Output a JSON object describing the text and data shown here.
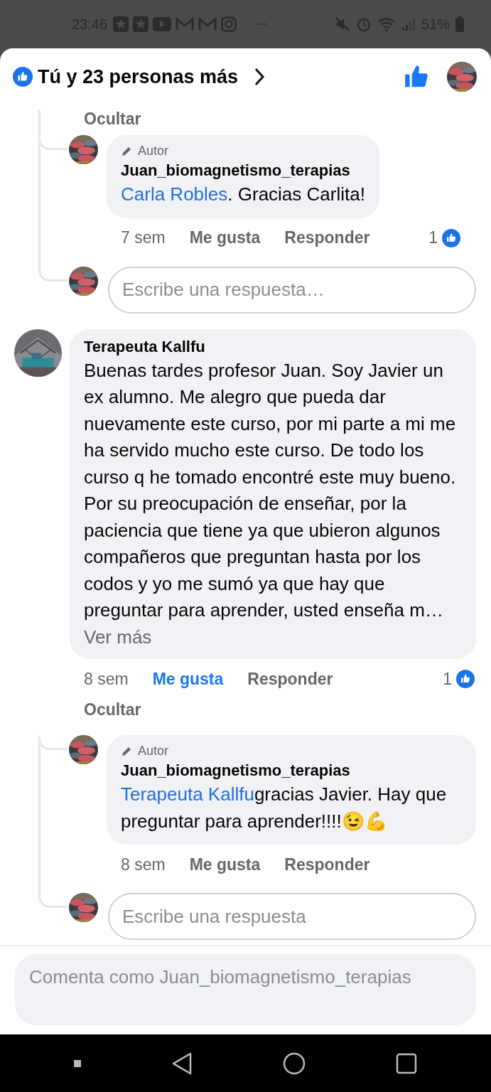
{
  "status_bar": {
    "time": "23:46",
    "battery": "51%"
  },
  "header": {
    "title": "Tú y 23 personas más"
  },
  "thread": [
    {
      "kind": "toggle",
      "text": "Ocultar"
    },
    {
      "kind": "reply",
      "badge": "Autor",
      "author": "Juan_biomagnetismo_terapias",
      "mention": "Carla Robles",
      "text": ". Gracias Carlita!",
      "time": "7 sem",
      "like": "Me gusta",
      "liked": false,
      "respond": "Responder",
      "reactions": "1"
    },
    {
      "kind": "reply_field",
      "placeholder": "Escribe una respuesta…"
    },
    {
      "kind": "comment",
      "author": "Terapeuta Kallfu",
      "text": "Buenas tardes profesor Juan. Soy Javier un ex alumno. Me alegro que pueda dar nuevamente este curso, por mi parte a mi me ha servido mucho este curso. De todo los curso q he tomado encontré este muy bueno. Por su preocupación de enseñar, por la paciencia que tiene ya que ubieron algunos compañeros que preguntan hasta por los codos y yo me sumó ya que hay que preguntar para aprender, usted enseña m…",
      "more": "Ver más",
      "time": "8 sem",
      "like": "Me gusta",
      "liked": true,
      "respond": "Responder",
      "reactions": "1",
      "toggle": "Ocultar"
    },
    {
      "kind": "reply",
      "badge": "Autor",
      "author": "Juan_biomagnetismo_terapias",
      "mention": "Terapeuta Kallfu",
      "text": "gracias Javier. Hay que preguntar para aprender!!!!😉💪",
      "time": "8 sem",
      "like": "Me gusta",
      "liked": false,
      "respond": "Responder"
    },
    {
      "kind": "reply_field",
      "placeholder": "Escribe una respuesta"
    }
  ],
  "composer": {
    "placeholder": "Comenta como Juan_biomagnetismo_terapias"
  }
}
